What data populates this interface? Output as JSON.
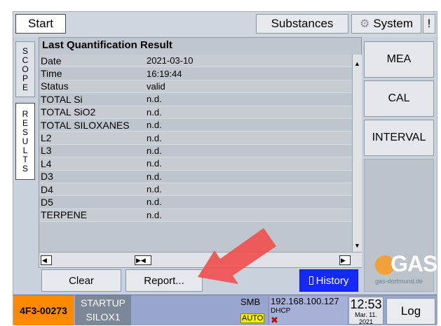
{
  "topbar": {
    "start_label": "Start",
    "substances_label": "Substances",
    "system_label": "System",
    "alert_label": "!"
  },
  "side_tabs": {
    "scope": [
      "S",
      "C",
      "O",
      "P",
      "E"
    ],
    "results": [
      "R",
      "E",
      "S",
      "U",
      "L",
      "T",
      "S"
    ]
  },
  "panel": {
    "title": "Last Quantification Result",
    "rows": [
      {
        "label": "Date",
        "value": "2021-03-10"
      },
      {
        "label": "Time",
        "value": "16:19:44"
      },
      {
        "label": "Status",
        "value": "valid"
      },
      {
        "label": "TOTAL Si",
        "value": "n.d."
      },
      {
        "label": "TOTAL SiO2",
        "value": "n.d."
      },
      {
        "label": "TOTAL SILOXANES",
        "value": "n.d."
      },
      {
        "label": "L2",
        "value": "n.d."
      },
      {
        "label": "L3",
        "value": "n.d."
      },
      {
        "label": "L4",
        "value": "n.d."
      },
      {
        "label": "D3",
        "value": "n.d."
      },
      {
        "label": "D4",
        "value": "n.d."
      },
      {
        "label": "D5",
        "value": "n.d."
      },
      {
        "label": "TERPENE",
        "value": "n.d."
      }
    ]
  },
  "right_buttons": {
    "mea": "MEA",
    "cal": "CAL",
    "interval": "INTERVAL"
  },
  "logo": {
    "text": "GAS",
    "subtext": "gas-dortmund.de"
  },
  "bottom_buttons": {
    "clear": "Clear",
    "report": "Report...",
    "history": "History"
  },
  "status": {
    "device_id": "4F3-00273",
    "mode_line1": "STARTUP",
    "mode_line2": "SILOX1",
    "smb": "SMB",
    "auto": "AUTO",
    "ip": "192.168.100.127",
    "dhcp": "DHCP",
    "error_mark": "✖",
    "time": "12:53",
    "date_line1": "Mar. 11.",
    "date_line2": "2021",
    "log_label": "Log"
  },
  "colors": {
    "accent_orange": "#ff8a00",
    "history_blue": "#1428ff",
    "arrow_red": "#f05050"
  }
}
